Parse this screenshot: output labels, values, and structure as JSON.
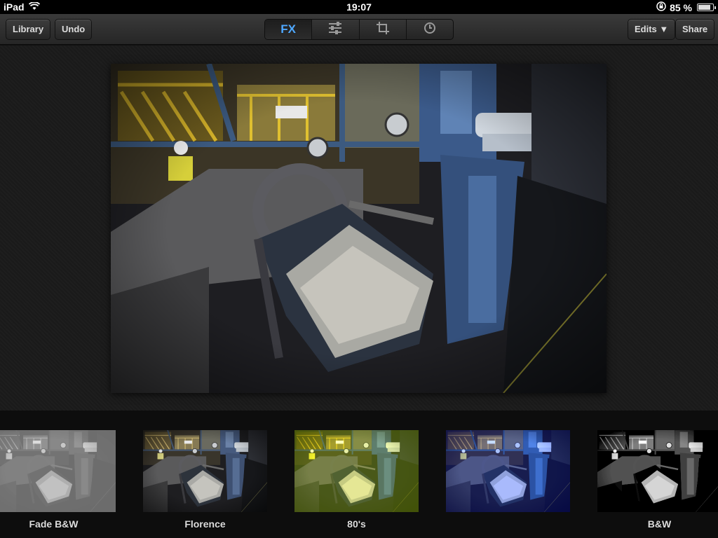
{
  "status": {
    "device": "iPad",
    "time": "19:07",
    "battery": "85 %",
    "battery_level": 0.85
  },
  "toolbar": {
    "library_label": "Library",
    "undo_label": "Undo",
    "edits_label": "Edits ▼",
    "share_label": "Share",
    "segments": [
      {
        "label": "FX",
        "icon": "fx-icon",
        "active": true
      },
      {
        "label": "",
        "icon": "sliders-icon",
        "active": false
      },
      {
        "label": "",
        "icon": "crop-icon",
        "active": false
      },
      {
        "label": "",
        "icon": "history-icon",
        "active": false
      }
    ]
  },
  "filters": [
    {
      "label": "Fade B&W",
      "style": "fade-bw"
    },
    {
      "label": "Florence",
      "style": "florence"
    },
    {
      "label": "80's",
      "style": "eighties"
    },
    {
      "label": "",
      "style": "blue"
    },
    {
      "label": "B&W",
      "style": "bw"
    }
  ],
  "colors": {
    "accent": "#4fa8ff"
  }
}
